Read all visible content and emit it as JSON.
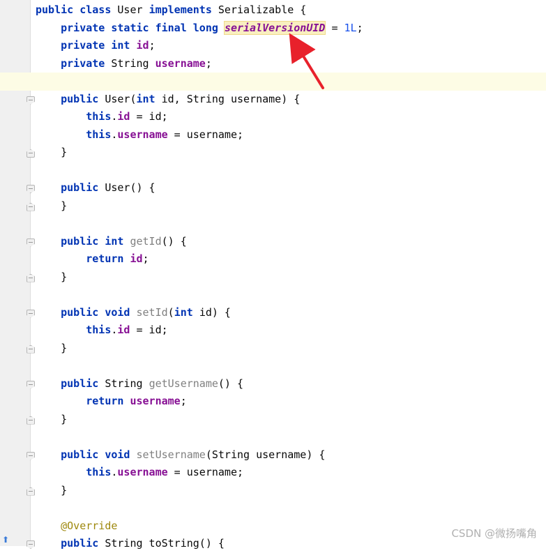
{
  "editor": {
    "lines": [
      {
        "parts": [
          [
            "kw",
            "public class "
          ],
          [
            "plain",
            "User "
          ],
          [
            "kw",
            "implements "
          ],
          [
            "plain",
            "Serializable {"
          ]
        ]
      },
      {
        "parts": [
          [
            "plain",
            "    "
          ],
          [
            "kw",
            "private static final long "
          ],
          [
            "sfld",
            "serialVersionUID"
          ],
          [
            "plain",
            " = "
          ],
          [
            "num",
            "1L"
          ],
          [
            "plain",
            ";"
          ]
        ]
      },
      {
        "parts": [
          [
            "plain",
            "    "
          ],
          [
            "kw",
            "private int "
          ],
          [
            "fld",
            "id"
          ],
          [
            "plain",
            ";"
          ]
        ]
      },
      {
        "parts": [
          [
            "plain",
            "    "
          ],
          [
            "kw",
            "private "
          ],
          [
            "plain",
            "String "
          ],
          [
            "fld",
            "username"
          ],
          [
            "plain",
            ";"
          ]
        ]
      },
      {
        "parts": [
          [
            "plain",
            ""
          ]
        ],
        "current": true
      },
      {
        "parts": [
          [
            "plain",
            "    "
          ],
          [
            "kw",
            "public "
          ],
          [
            "plain",
            "User("
          ],
          [
            "kw",
            "int "
          ],
          [
            "plain",
            "id, String username) {"
          ]
        ],
        "fold": "start"
      },
      {
        "parts": [
          [
            "plain",
            "        "
          ],
          [
            "kw",
            "this"
          ],
          [
            "plain",
            "."
          ],
          [
            "fld",
            "id"
          ],
          [
            "plain",
            " = id;"
          ]
        ]
      },
      {
        "parts": [
          [
            "plain",
            "        "
          ],
          [
            "kw",
            "this"
          ],
          [
            "plain",
            "."
          ],
          [
            "fld",
            "username"
          ],
          [
            "plain",
            " = username;"
          ]
        ]
      },
      {
        "parts": [
          [
            "plain",
            "    }"
          ]
        ],
        "fold": "end"
      },
      {
        "parts": [
          [
            "plain",
            ""
          ]
        ]
      },
      {
        "parts": [
          [
            "plain",
            "    "
          ],
          [
            "kw",
            "public "
          ],
          [
            "plain",
            "User() {"
          ]
        ],
        "fold": "start"
      },
      {
        "parts": [
          [
            "plain",
            "    }"
          ]
        ],
        "fold": "end"
      },
      {
        "parts": [
          [
            "plain",
            ""
          ]
        ]
      },
      {
        "parts": [
          [
            "plain",
            "    "
          ],
          [
            "kw",
            "public int "
          ],
          [
            "mth-unused",
            "getId"
          ],
          [
            "plain",
            "() {"
          ]
        ],
        "fold": "start"
      },
      {
        "parts": [
          [
            "plain",
            "        "
          ],
          [
            "kw",
            "return "
          ],
          [
            "fld",
            "id"
          ],
          [
            "plain",
            ";"
          ]
        ]
      },
      {
        "parts": [
          [
            "plain",
            "    }"
          ]
        ],
        "fold": "end"
      },
      {
        "parts": [
          [
            "plain",
            ""
          ]
        ]
      },
      {
        "parts": [
          [
            "plain",
            "    "
          ],
          [
            "kw",
            "public void "
          ],
          [
            "mth-unused",
            "setId"
          ],
          [
            "plain",
            "("
          ],
          [
            "kw",
            "int "
          ],
          [
            "plain",
            "id) {"
          ]
        ],
        "fold": "start"
      },
      {
        "parts": [
          [
            "plain",
            "        "
          ],
          [
            "kw",
            "this"
          ],
          [
            "plain",
            "."
          ],
          [
            "fld",
            "id"
          ],
          [
            "plain",
            " = id;"
          ]
        ]
      },
      {
        "parts": [
          [
            "plain",
            "    }"
          ]
        ],
        "fold": "end"
      },
      {
        "parts": [
          [
            "plain",
            ""
          ]
        ]
      },
      {
        "parts": [
          [
            "plain",
            "    "
          ],
          [
            "kw",
            "public "
          ],
          [
            "plain",
            "String "
          ],
          [
            "mth-unused",
            "getUsername"
          ],
          [
            "plain",
            "() {"
          ]
        ],
        "fold": "start"
      },
      {
        "parts": [
          [
            "plain",
            "        "
          ],
          [
            "kw",
            "return "
          ],
          [
            "fld",
            "username"
          ],
          [
            "plain",
            ";"
          ]
        ]
      },
      {
        "parts": [
          [
            "plain",
            "    }"
          ]
        ],
        "fold": "end"
      },
      {
        "parts": [
          [
            "plain",
            ""
          ]
        ]
      },
      {
        "parts": [
          [
            "plain",
            "    "
          ],
          [
            "kw",
            "public void "
          ],
          [
            "mth-unused",
            "setUsername"
          ],
          [
            "plain",
            "(String username) {"
          ]
        ],
        "fold": "start"
      },
      {
        "parts": [
          [
            "plain",
            "        "
          ],
          [
            "kw",
            "this"
          ],
          [
            "plain",
            "."
          ],
          [
            "fld",
            "username"
          ],
          [
            "plain",
            " = username;"
          ]
        ]
      },
      {
        "parts": [
          [
            "plain",
            "    }"
          ]
        ],
        "fold": "end"
      },
      {
        "parts": [
          [
            "plain",
            ""
          ]
        ]
      },
      {
        "parts": [
          [
            "plain",
            "    "
          ],
          [
            "ann",
            "@Override"
          ]
        ]
      },
      {
        "parts": [
          [
            "plain",
            "    "
          ],
          [
            "kw",
            "public "
          ],
          [
            "plain",
            "String toString() {"
          ]
        ],
        "fold": "start"
      }
    ]
  },
  "annotation_arrow": {
    "color": "#e8212b"
  },
  "watermark": "CSDN @微扬嘴角"
}
